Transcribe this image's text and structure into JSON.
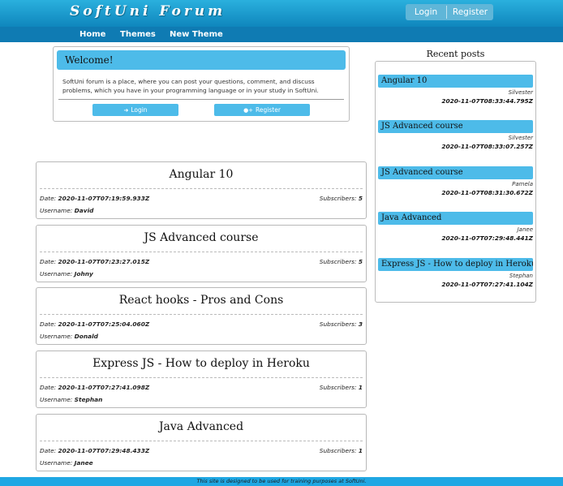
{
  "header": {
    "brand": "SoftUni Forum",
    "login": "Login",
    "register": "Register"
  },
  "nav": [
    "Home",
    "Themes",
    "New Theme"
  ],
  "welcome": {
    "title": "Welcome!",
    "text": "SoftUni forum is a place, where you can post your questions, comment, and discuss problems, which you have in your programming language or in your study in SoftUni.",
    "login_button": "Login",
    "register_button": "Register"
  },
  "labels": {
    "date": "Date:",
    "subscribers": "Subscribers:",
    "username": "Username:"
  },
  "themes": [
    {
      "title": "Angular 10",
      "date": "2020-11-07T07:19:59.933Z",
      "subscribers": "5",
      "username": "David"
    },
    {
      "title": "JS Advanced course",
      "date": "2020-11-07T07:23:27.015Z",
      "subscribers": "5",
      "username": "Johny"
    },
    {
      "title": "React hooks - Pros and Cons",
      "date": "2020-11-07T07:25:04.060Z",
      "subscribers": "3",
      "username": "Donald"
    },
    {
      "title": "Express JS - How to deploy in Heroku",
      "date": "2020-11-07T07:27:41.098Z",
      "subscribers": "1",
      "username": "Stephan"
    },
    {
      "title": "Java Advanced",
      "date": "2020-11-07T07:29:48.433Z",
      "subscribers": "1",
      "username": "Janee"
    }
  ],
  "recent": {
    "heading": "Recent posts",
    "posts": [
      {
        "title": "Angular 10",
        "author": "Silvester",
        "date": "2020-11-07T08:33:44.795Z"
      },
      {
        "title": "JS Advanced course",
        "author": "Silvester",
        "date": "2020-11-07T08:33:07.257Z"
      },
      {
        "title": "JS Advanced course",
        "author": "Pamela",
        "date": "2020-11-07T08:31:30.672Z"
      },
      {
        "title": "Java Advanced",
        "author": "Janee",
        "date": "2020-11-07T07:29:48.441Z"
      },
      {
        "title": "Express JS - How to deploy in Heroku",
        "author": "Stephan",
        "date": "2020-11-07T07:27:41.104Z"
      }
    ]
  },
  "footer": "This site is designed to be used for training purposes at SoftUni.",
  "icons": {
    "login_icon": "sign-in-icon",
    "register_icon": "user-plus-icon"
  },
  "colors": {
    "header_top": "#2ab0de",
    "nav": "#0f7bb3",
    "accent": "#4dbbe9",
    "footer": "#1fa7e3"
  }
}
